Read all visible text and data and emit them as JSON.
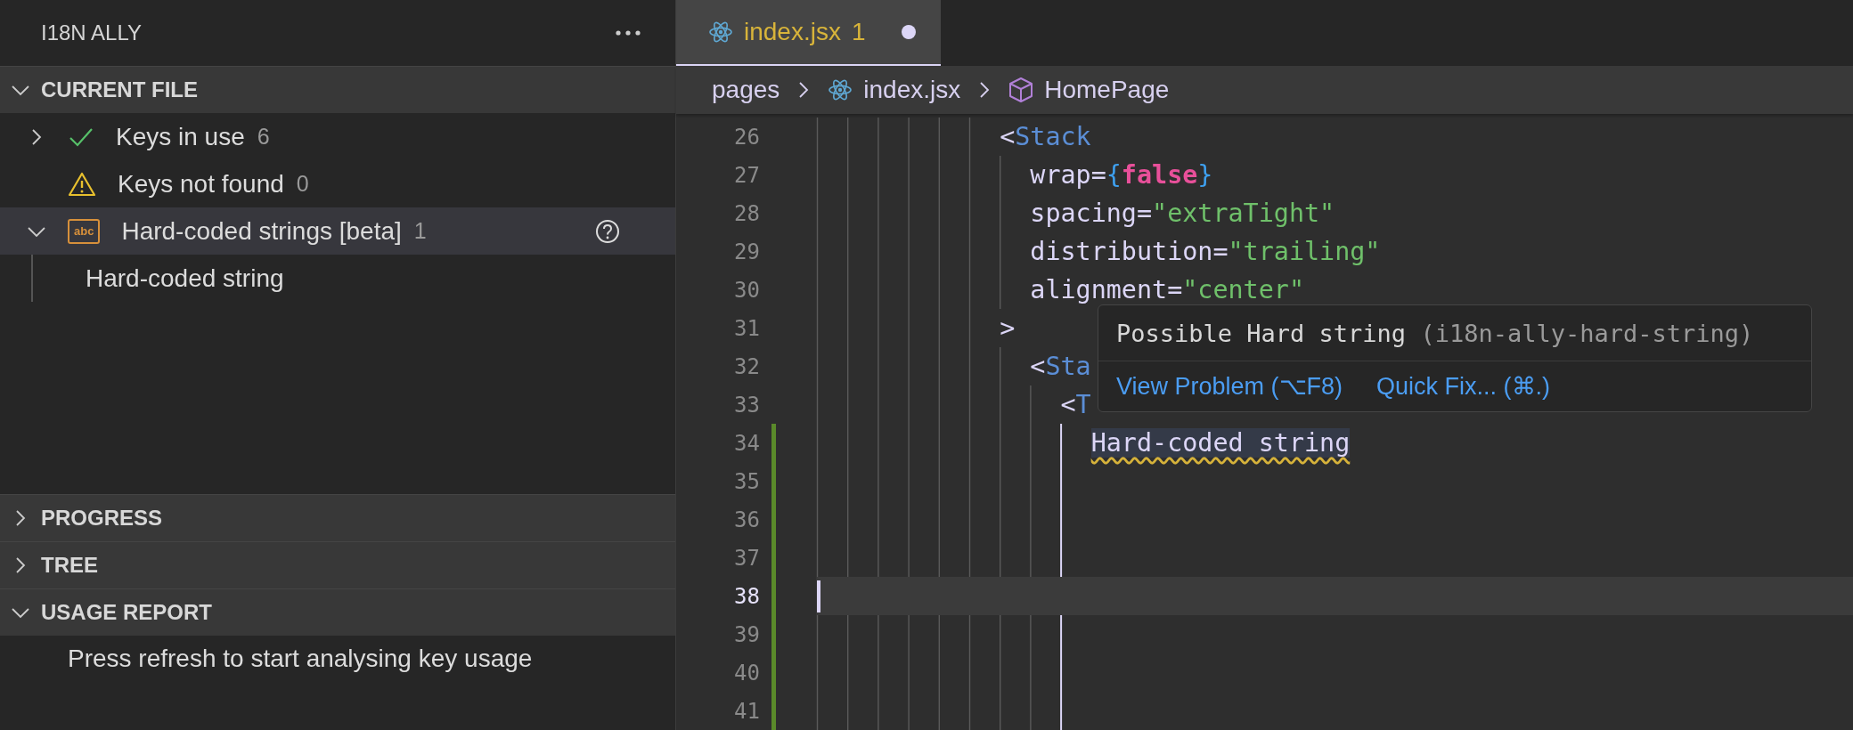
{
  "sidebar": {
    "title": "I18N ALLY",
    "sections": [
      {
        "title": "CURRENT FILE",
        "expanded": true,
        "items": [
          {
            "kind": "check",
            "label": "Keys in use",
            "count": "6",
            "expanded": false,
            "selected": false
          },
          {
            "kind": "warning",
            "label": "Keys not found",
            "count": "0",
            "selected": false
          },
          {
            "kind": "abc",
            "badge": "abc",
            "label": "Hard-coded strings [beta]",
            "count": "1",
            "expanded": true,
            "selected": true,
            "help": true,
            "children": [
              {
                "label": "Hard-coded string"
              }
            ]
          }
        ]
      },
      {
        "title": "PROGRESS",
        "expanded": false
      },
      {
        "title": "TREE",
        "expanded": false
      },
      {
        "title": "USAGE REPORT",
        "expanded": true,
        "message": "Press refresh to start analysing key usage"
      }
    ]
  },
  "tabs": [
    {
      "label": "index.jsx",
      "problems": "1",
      "dirty": true,
      "selected": true
    }
  ],
  "breadcrumb": [
    {
      "kind": "folder",
      "label": "pages"
    },
    {
      "kind": "react",
      "label": "index.jsx"
    },
    {
      "kind": "component",
      "label": "HomePage"
    }
  ],
  "editor": {
    "lines": [
      {
        "number": "26",
        "changed": false,
        "current": false,
        "tokens": [
          {
            "kind": "plain",
            "text": "            <"
          },
          {
            "kind": "deprecated",
            "text": "Stack"
          }
        ]
      },
      {
        "number": "27",
        "changed": false,
        "current": false,
        "tokens": [
          {
            "kind": "plain",
            "text": "              wrap="
          },
          {
            "kind": "brace",
            "text": "{"
          },
          {
            "kind": "keyword",
            "text": "false"
          },
          {
            "kind": "brace",
            "text": "}"
          }
        ]
      },
      {
        "number": "28",
        "changed": false,
        "current": false,
        "tokens": [
          {
            "kind": "plain",
            "text": "              spacing="
          },
          {
            "kind": "string",
            "text": "\"extraTight\""
          }
        ]
      },
      {
        "number": "29",
        "changed": false,
        "current": false,
        "tokens": [
          {
            "kind": "plain",
            "text": "              distribution="
          },
          {
            "kind": "string",
            "text": "\"trailing\""
          }
        ]
      },
      {
        "number": "30",
        "changed": false,
        "current": false,
        "tokens": [
          {
            "kind": "plain",
            "text": "              alignment="
          },
          {
            "kind": "string",
            "text": "\"center\""
          }
        ]
      },
      {
        "number": "31",
        "changed": false,
        "current": false,
        "tokens": [
          {
            "kind": "plain",
            "text": "            >"
          }
        ]
      },
      {
        "number": "32",
        "changed": false,
        "current": false,
        "tokens": [
          {
            "kind": "plain",
            "text": "              <"
          },
          {
            "kind": "deprecated",
            "text": "Sta"
          }
        ]
      },
      {
        "number": "33",
        "changed": false,
        "current": false,
        "tokens": [
          {
            "kind": "plain",
            "text": "                <"
          },
          {
            "kind": "deprecated",
            "text": "T"
          }
        ]
      },
      {
        "number": "34",
        "changed": true,
        "current": false,
        "tokens": [
          {
            "kind": "hardstring",
            "text": "                  Hard-coded string"
          }
        ]
      },
      {
        "number": "35",
        "changed": true,
        "current": false
      },
      {
        "number": "36",
        "changed": true,
        "current": false
      },
      {
        "number": "37",
        "changed": true,
        "current": false
      },
      {
        "number": "38",
        "changed": true,
        "current": true
      },
      {
        "number": "39",
        "changed": true,
        "current": false
      },
      {
        "number": "40",
        "changed": true,
        "current": false
      },
      {
        "number": "41",
        "changed": true,
        "current": false
      }
    ]
  },
  "hover": {
    "message": "Possible Hard string",
    "source": "(i18n-ally-hard-string)",
    "actions": [
      "View Problem (⌥F8)",
      "Quick Fix... (⌘.)"
    ]
  }
}
